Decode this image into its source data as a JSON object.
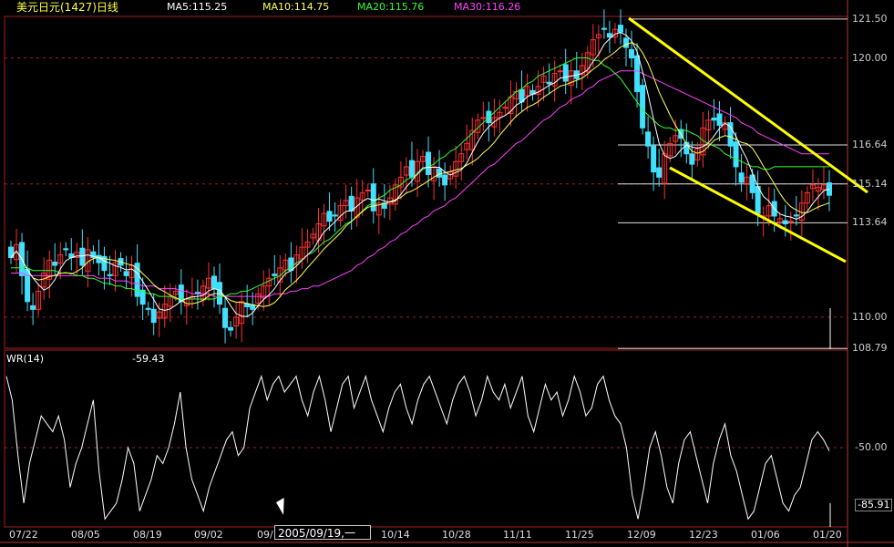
{
  "header": {
    "title": "美元日元(1427)日线",
    "ma5": "MA5:115.25",
    "ma10": "MA10:114.75",
    "ma20": "MA20:115.76",
    "ma30": "MA30:116.26"
  },
  "indicator": {
    "name": "WR(14)",
    "value": "-59.43"
  },
  "cursor": {
    "date_text": "2005/09/19,一"
  },
  "colors": {
    "background": "#000000",
    "up": "#ff3030",
    "down": "#40e0ff",
    "ma5": "#ffffff",
    "ma10": "#ffff60",
    "ma20": "#30ff30",
    "ma30": "#ff40ff",
    "trendline": "#ffff00",
    "grid": "#a02020"
  },
  "chart_data": [
    {
      "type": "candlestick",
      "y_tick_labels": [
        "121.50",
        "120.00",
        "116.64",
        "115.14",
        "113.64",
        "110.00",
        "108.79"
      ],
      "ylim": [
        108.8,
        121.6
      ],
      "x_tick_labels": [
        "07/22",
        "08/05",
        "08/19",
        "09/02",
        "09/",
        "10/14",
        "10/28",
        "11/11",
        "11/25",
        "12/09",
        "12/23",
        "01/06",
        "01/20"
      ],
      "close": [
        112.3,
        112.8,
        111.6,
        110.6,
        110.3,
        111.0,
        111.7,
        112.2,
        112.0,
        112.4,
        112.6,
        112.3,
        112.5,
        112.0,
        112.6,
        112.3,
        112.1,
        111.8,
        111.6,
        112.1,
        112.0,
        111.6,
        112.0,
        110.8,
        110.5,
        110.3,
        109.8,
        110.2,
        110.5,
        110.8,
        111.0,
        110.6,
        110.7,
        110.8,
        110.9,
        111.2,
        111.5,
        111.1,
        110.5,
        109.6,
        109.5,
        110.0,
        110.6,
        110.4,
        110.3,
        110.9,
        111.2,
        111.5,
        111.6,
        111.9,
        112.2,
        111.8,
        112.4,
        112.7,
        112.9,
        113.2,
        113.6,
        114.0,
        113.7,
        113.9,
        114.3,
        114.5,
        114.1,
        114.6,
        114.8,
        114.9,
        114.1,
        114.4,
        114.2,
        114.6,
        115.1,
        115.4,
        115.8,
        115.4,
        116.0,
        116.2,
        115.5,
        115.8,
        115.4,
        115.1,
        115.6,
        116.0,
        116.3,
        116.7,
        117.2,
        117.6,
        117.7,
        117.5,
        117.7,
        117.9,
        118.1,
        118.5,
        118.7,
        118.3,
        118.9,
        118.6,
        118.9,
        119.3,
        119.0,
        119.4,
        119.5,
        119.1,
        119.5,
        119.2,
        119.7,
        120.2,
        120.7,
        120.9,
        121.1,
        120.8,
        121.1,
        121.0,
        120.4,
        120.0,
        118.7,
        117.3,
        116.6,
        115.6,
        115.4,
        116.3,
        116.7,
        117.0,
        116.9,
        116.3,
        115.9,
        116.5,
        117.3,
        117.6,
        117.6,
        117.4,
        117.5,
        116.6,
        115.8,
        115.2,
        115.4,
        114.8,
        114.0,
        113.9,
        114.3,
        113.9,
        113.8,
        113.6,
        113.7,
        113.9,
        114.4,
        114.8,
        115.1,
        115.0,
        115.1,
        114.7
      ],
      "ma30": [
        111.7,
        111.7,
        111.7,
        111.6,
        111.6,
        111.6,
        111.6,
        111.6,
        111.6,
        111.6,
        111.6,
        111.6,
        111.6,
        111.6,
        111.6,
        111.6,
        111.5,
        111.5,
        111.5,
        111.4,
        111.4,
        111.4,
        111.3,
        111.3,
        111.2,
        111.2,
        111.2,
        111.1,
        111.1,
        111.1,
        111.1,
        111.0,
        111.0,
        110.9,
        110.9,
        110.9,
        110.9,
        110.8,
        110.8,
        110.8,
        110.8,
        110.8,
        110.8,
        110.8,
        110.8,
        110.8,
        110.8,
        110.8,
        110.9,
        110.9,
        110.9,
        111.0,
        111.0,
        111.1,
        111.1,
        111.2,
        111.2,
        111.3,
        111.4,
        111.5,
        111.6,
        111.7,
        111.8,
        112.0,
        112.1,
        112.3,
        112.4,
        112.6,
        112.7,
        112.9,
        113.0,
        113.2,
        113.3,
        113.5,
        113.6,
        113.8,
        113.9,
        114.1,
        114.2,
        114.3,
        114.5,
        114.6,
        114.8,
        115.0,
        115.2,
        115.4,
        115.6,
        115.8,
        115.9,
        116.1,
        116.3,
        116.5,
        116.7,
        116.8,
        117.0,
        117.2,
        117.4,
        117.6,
        117.7,
        117.9,
        118.1,
        118.2,
        118.4,
        118.5,
        118.6,
        118.8,
        118.9,
        119.1,
        119.2,
        119.3,
        119.4,
        119.5,
        119.5,
        119.5,
        119.5,
        119.4,
        119.3,
        119.2,
        119.1,
        119.0,
        118.9,
        118.8,
        118.7,
        118.6,
        118.5,
        118.4,
        118.3,
        118.2,
        118.1,
        118.0,
        117.9,
        117.8,
        117.7,
        117.5,
        117.4,
        117.3,
        117.1,
        117.0,
        116.9,
        116.8,
        116.7,
        116.6,
        116.5,
        116.4,
        116.3,
        116.3,
        116.3,
        116.3,
        116.3,
        116.3
      ],
      "ma20": [
        111.9,
        111.9,
        111.9,
        111.9,
        111.8,
        111.8,
        111.8,
        111.8,
        111.8,
        111.7,
        111.7,
        111.7,
        111.6,
        111.6,
        111.5,
        111.5,
        111.4,
        111.3,
        111.3,
        111.2,
        111.2,
        111.1,
        111.1,
        111.0,
        111.0,
        110.9,
        110.9,
        110.8,
        110.8,
        110.8,
        110.7,
        110.7,
        110.7,
        110.7,
        110.7,
        110.7,
        110.7,
        110.7,
        110.8,
        110.8,
        110.9,
        110.9,
        111.0,
        111.0,
        111.1,
        111.2,
        111.3,
        111.4,
        111.5,
        111.6,
        111.8,
        111.9,
        112.1,
        112.2,
        112.4,
        112.5,
        112.7,
        112.9,
        113.0,
        113.2,
        113.4,
        113.6,
        113.7,
        113.9,
        114.1,
        114.3,
        114.4,
        114.6,
        114.7,
        114.9,
        115.0,
        115.1,
        115.3,
        115.4,
        115.5,
        115.7,
        115.8,
        115.9,
        116.1,
        116.2,
        116.4,
        116.5,
        116.7,
        116.9,
        117.1,
        117.3,
        117.5,
        117.7,
        117.9,
        118.1,
        118.3,
        118.5,
        118.7,
        118.8,
        119.0,
        119.1,
        119.3,
        119.4,
        119.5,
        119.6,
        119.7,
        119.8,
        119.9,
        120.0,
        120.0,
        120.0,
        119.9,
        119.9,
        119.7,
        119.6,
        119.4,
        119.2,
        118.9,
        118.6,
        118.3,
        118.0,
        117.8,
        117.6,
        117.4,
        117.3,
        117.3,
        117.2,
        117.2,
        117.2,
        117.1,
        117.0,
        116.8,
        116.7,
        116.6,
        116.5,
        116.3,
        116.2,
        116.1,
        116.0,
        115.9,
        115.8,
        115.8,
        115.7,
        115.7,
        115.8,
        115.8,
        115.8,
        115.8,
        115.8,
        115.8,
        115.8,
        115.8,
        115.8,
        115.8,
        115.8
      ]
    },
    {
      "type": "line",
      "name": "WR(14)",
      "y_tick_labels": [
        "-50.00",
        "-85.91"
      ],
      "ylim": [
        -100,
        0
      ],
      "values": [
        -5,
        -20,
        -55,
        -85,
        -60,
        -45,
        -30,
        -35,
        -40,
        -30,
        -45,
        -75,
        -60,
        -50,
        -35,
        -20,
        -65,
        -95,
        -90,
        -85,
        -70,
        -50,
        -60,
        -90,
        -80,
        -70,
        -55,
        -60,
        -50,
        -35,
        -15,
        -50,
        -70,
        -80,
        -90,
        -75,
        -65,
        -55,
        -45,
        -40,
        -55,
        -50,
        -25,
        -15,
        -5,
        -20,
        -10,
        -5,
        -15,
        -10,
        -5,
        -20,
        -30,
        -15,
        -5,
        -20,
        -40,
        -25,
        -10,
        -5,
        -25,
        -15,
        -5,
        -20,
        -30,
        -40,
        -25,
        -15,
        -10,
        -25,
        -35,
        -20,
        -10,
        -5,
        -15,
        -25,
        -35,
        -20,
        -10,
        -5,
        -15,
        -30,
        -20,
        -5,
        -15,
        -20,
        -10,
        -25,
        -15,
        -5,
        -30,
        -40,
        -25,
        -10,
        -20,
        -15,
        -30,
        -20,
        -5,
        -15,
        -30,
        -25,
        -10,
        -5,
        -20,
        -30,
        -35,
        -50,
        -80,
        -95,
        -75,
        -50,
        -40,
        -55,
        -75,
        -85,
        -60,
        -45,
        -40,
        -55,
        -70,
        -85,
        -60,
        -45,
        -35,
        -55,
        -65,
        -80,
        -95,
        -90,
        -75,
        -60,
        -55,
        -70,
        -85,
        -90,
        -80,
        -75,
        -60,
        -45,
        -40,
        -45,
        -52
      ]
    }
  ]
}
